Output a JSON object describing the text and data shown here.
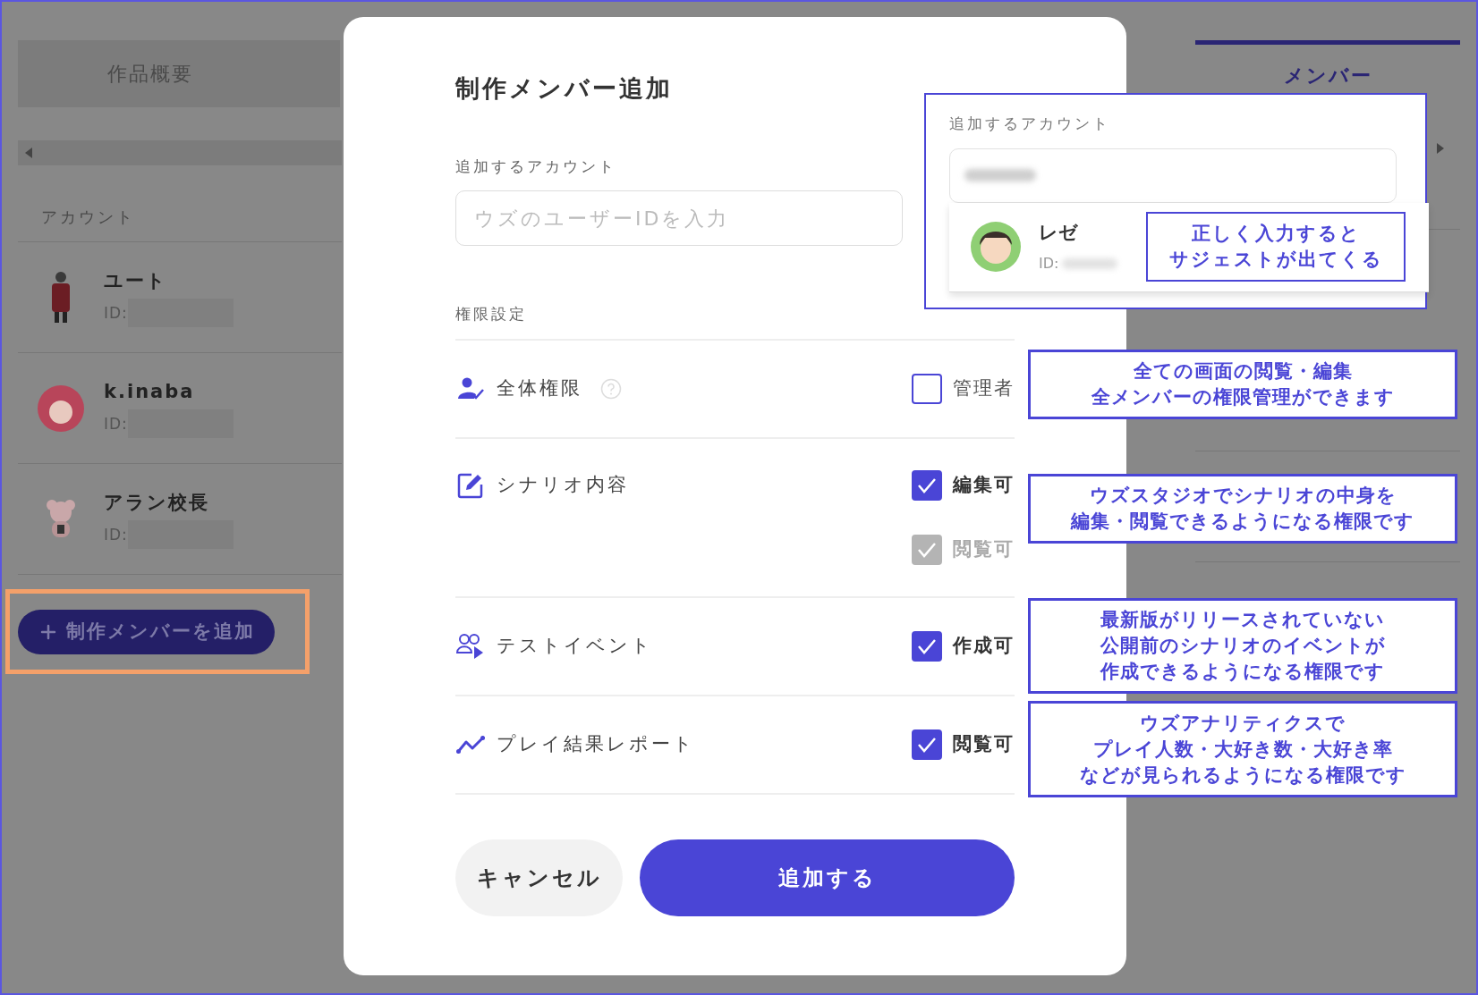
{
  "background": {
    "tabs": [
      {
        "label": "作品概要",
        "selected": false
      },
      {
        "label": "メンバー",
        "selected": true
      }
    ],
    "members_header": "アカウント",
    "members": [
      {
        "name": "ユート",
        "id_label": "ID:",
        "kind": "figure"
      },
      {
        "name": "k.inaba",
        "id_label": "ID:",
        "kind": "round"
      },
      {
        "name": "アラン校長",
        "id_label": "ID:",
        "kind": "bear"
      }
    ],
    "add_member_button": "制作メンバーを追加"
  },
  "modal": {
    "title": "制作メンバー追加",
    "account_label": "追加するアカウント",
    "account_placeholder": "ウズのユーザーIDを入力",
    "permissions_label": "権限設定",
    "permissions": [
      {
        "label": "全体権限",
        "kind": "admin",
        "help": true,
        "options": [
          {
            "label": "管理者",
            "checked": false,
            "disabled": false
          }
        ]
      },
      {
        "label": "シナリオ内容",
        "kind": "edit",
        "help": false,
        "options": [
          {
            "label": "編集可",
            "checked": true,
            "disabled": false
          },
          {
            "label": "閲覧可",
            "checked": true,
            "disabled": true
          }
        ]
      },
      {
        "label": "テストイベント",
        "kind": "event",
        "help": false,
        "options": [
          {
            "label": "作成可",
            "checked": true,
            "disabled": false
          }
        ]
      },
      {
        "label": "プレイ結果レポート",
        "kind": "report",
        "help": false,
        "options": [
          {
            "label": "閲覧可",
            "checked": true,
            "disabled": false
          }
        ]
      }
    ],
    "cancel_button": "キャンセル",
    "submit_button": "追加する"
  },
  "suggestion": {
    "label": "追加するアカウント",
    "result": {
      "name": "レゼ",
      "id_label": "ID:"
    },
    "note": [
      "正しく入力すると",
      "サジェストが出てくる"
    ]
  },
  "annotations": [
    {
      "lines": [
        "全ての画面の閲覧・編集",
        "全メンバーの権限管理ができます"
      ]
    },
    {
      "lines": [
        "ウズスタジオでシナリオの中身を",
        "編集・閲覧できるようになる権限です"
      ]
    },
    {
      "lines": [
        "最新版がリリースされていない",
        "公開前のシナリオのイベントが",
        "作成できるようになる権限です"
      ]
    },
    {
      "lines": [
        "ウズアナリティクスで",
        "プレイ人数・大好き数・大好き率",
        "などが見られるようになる権限です"
      ]
    }
  ]
}
